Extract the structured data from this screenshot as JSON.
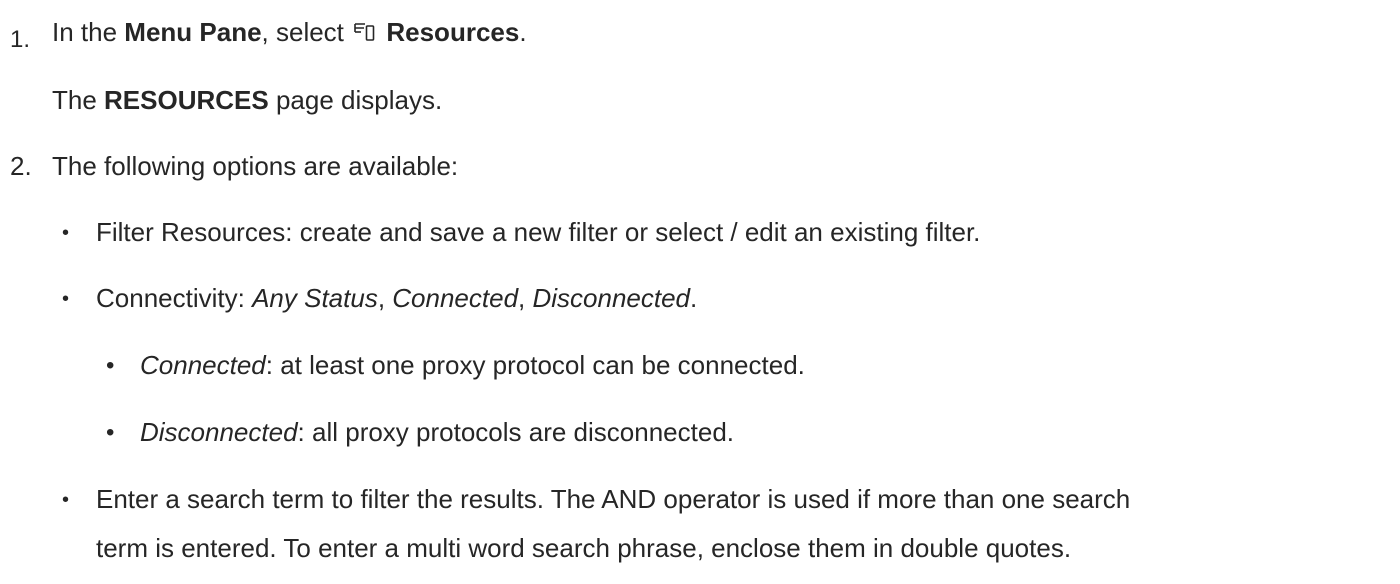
{
  "steps": [
    {
      "number": "1.",
      "parts": {
        "a": "In the ",
        "b": "Menu Pane",
        "c": ", select ",
        "d": "Resources",
        "e": "."
      },
      "icon": "resources-icon",
      "result": {
        "a": "The ",
        "b": "RESOURCES",
        "c": " page displays."
      }
    },
    {
      "number": "2.",
      "text": "The following options are available:",
      "bullets": [
        {
          "text": "Filter Resources: create and save a new filter or select / edit an existing filter."
        },
        {
          "a": "Connectivity: ",
          "b": "Any Status",
          "c": ", ",
          "d": "Connected",
          "e": ", ",
          "f": "Disconnected",
          "g": "."
        },
        {
          "a": "Connected",
          "b": ": at least one proxy protocol can be connected."
        },
        {
          "a": "Disconnected",
          "b": ": all proxy protocols are disconnected."
        },
        {
          "line1": "Enter a search term to filter the results. The AND operator is used if more than one search",
          "line2": "term is entered. To enter a multi word search phrase, enclose them in double quotes."
        }
      ]
    }
  ],
  "bullet_char": "•"
}
